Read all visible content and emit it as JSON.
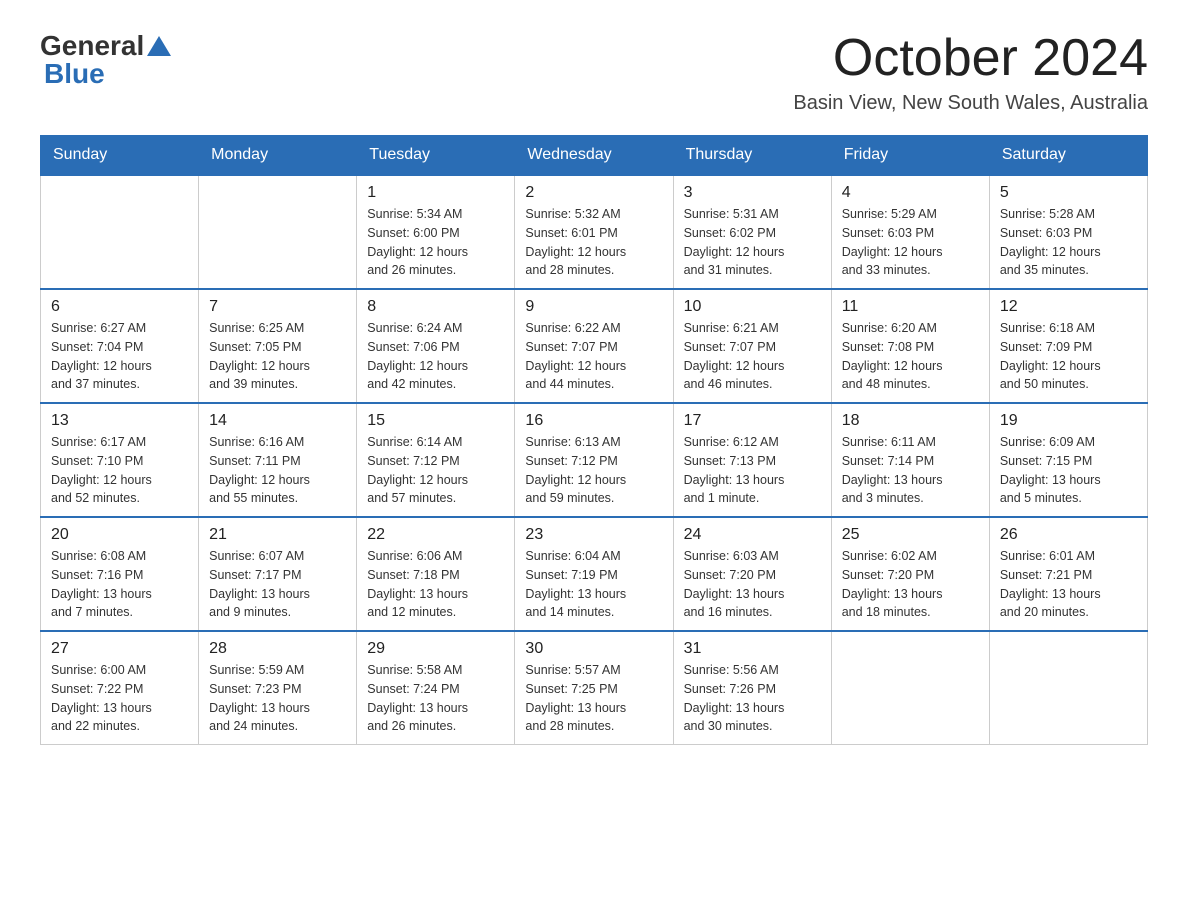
{
  "header": {
    "logo_general": "General",
    "logo_blue": "Blue",
    "month_title": "October 2024",
    "location": "Basin View, New South Wales, Australia"
  },
  "weekdays": [
    "Sunday",
    "Monday",
    "Tuesday",
    "Wednesday",
    "Thursday",
    "Friday",
    "Saturday"
  ],
  "weeks": [
    [
      {
        "day": "",
        "info": ""
      },
      {
        "day": "",
        "info": ""
      },
      {
        "day": "1",
        "info": "Sunrise: 5:34 AM\nSunset: 6:00 PM\nDaylight: 12 hours\nand 26 minutes."
      },
      {
        "day": "2",
        "info": "Sunrise: 5:32 AM\nSunset: 6:01 PM\nDaylight: 12 hours\nand 28 minutes."
      },
      {
        "day": "3",
        "info": "Sunrise: 5:31 AM\nSunset: 6:02 PM\nDaylight: 12 hours\nand 31 minutes."
      },
      {
        "day": "4",
        "info": "Sunrise: 5:29 AM\nSunset: 6:03 PM\nDaylight: 12 hours\nand 33 minutes."
      },
      {
        "day": "5",
        "info": "Sunrise: 5:28 AM\nSunset: 6:03 PM\nDaylight: 12 hours\nand 35 minutes."
      }
    ],
    [
      {
        "day": "6",
        "info": "Sunrise: 6:27 AM\nSunset: 7:04 PM\nDaylight: 12 hours\nand 37 minutes."
      },
      {
        "day": "7",
        "info": "Sunrise: 6:25 AM\nSunset: 7:05 PM\nDaylight: 12 hours\nand 39 minutes."
      },
      {
        "day": "8",
        "info": "Sunrise: 6:24 AM\nSunset: 7:06 PM\nDaylight: 12 hours\nand 42 minutes."
      },
      {
        "day": "9",
        "info": "Sunrise: 6:22 AM\nSunset: 7:07 PM\nDaylight: 12 hours\nand 44 minutes."
      },
      {
        "day": "10",
        "info": "Sunrise: 6:21 AM\nSunset: 7:07 PM\nDaylight: 12 hours\nand 46 minutes."
      },
      {
        "day": "11",
        "info": "Sunrise: 6:20 AM\nSunset: 7:08 PM\nDaylight: 12 hours\nand 48 minutes."
      },
      {
        "day": "12",
        "info": "Sunrise: 6:18 AM\nSunset: 7:09 PM\nDaylight: 12 hours\nand 50 minutes."
      }
    ],
    [
      {
        "day": "13",
        "info": "Sunrise: 6:17 AM\nSunset: 7:10 PM\nDaylight: 12 hours\nand 52 minutes."
      },
      {
        "day": "14",
        "info": "Sunrise: 6:16 AM\nSunset: 7:11 PM\nDaylight: 12 hours\nand 55 minutes."
      },
      {
        "day": "15",
        "info": "Sunrise: 6:14 AM\nSunset: 7:12 PM\nDaylight: 12 hours\nand 57 minutes."
      },
      {
        "day": "16",
        "info": "Sunrise: 6:13 AM\nSunset: 7:12 PM\nDaylight: 12 hours\nand 59 minutes."
      },
      {
        "day": "17",
        "info": "Sunrise: 6:12 AM\nSunset: 7:13 PM\nDaylight: 13 hours\nand 1 minute."
      },
      {
        "day": "18",
        "info": "Sunrise: 6:11 AM\nSunset: 7:14 PM\nDaylight: 13 hours\nand 3 minutes."
      },
      {
        "day": "19",
        "info": "Sunrise: 6:09 AM\nSunset: 7:15 PM\nDaylight: 13 hours\nand 5 minutes."
      }
    ],
    [
      {
        "day": "20",
        "info": "Sunrise: 6:08 AM\nSunset: 7:16 PM\nDaylight: 13 hours\nand 7 minutes."
      },
      {
        "day": "21",
        "info": "Sunrise: 6:07 AM\nSunset: 7:17 PM\nDaylight: 13 hours\nand 9 minutes."
      },
      {
        "day": "22",
        "info": "Sunrise: 6:06 AM\nSunset: 7:18 PM\nDaylight: 13 hours\nand 12 minutes."
      },
      {
        "day": "23",
        "info": "Sunrise: 6:04 AM\nSunset: 7:19 PM\nDaylight: 13 hours\nand 14 minutes."
      },
      {
        "day": "24",
        "info": "Sunrise: 6:03 AM\nSunset: 7:20 PM\nDaylight: 13 hours\nand 16 minutes."
      },
      {
        "day": "25",
        "info": "Sunrise: 6:02 AM\nSunset: 7:20 PM\nDaylight: 13 hours\nand 18 minutes."
      },
      {
        "day": "26",
        "info": "Sunrise: 6:01 AM\nSunset: 7:21 PM\nDaylight: 13 hours\nand 20 minutes."
      }
    ],
    [
      {
        "day": "27",
        "info": "Sunrise: 6:00 AM\nSunset: 7:22 PM\nDaylight: 13 hours\nand 22 minutes."
      },
      {
        "day": "28",
        "info": "Sunrise: 5:59 AM\nSunset: 7:23 PM\nDaylight: 13 hours\nand 24 minutes."
      },
      {
        "day": "29",
        "info": "Sunrise: 5:58 AM\nSunset: 7:24 PM\nDaylight: 13 hours\nand 26 minutes."
      },
      {
        "day": "30",
        "info": "Sunrise: 5:57 AM\nSunset: 7:25 PM\nDaylight: 13 hours\nand 28 minutes."
      },
      {
        "day": "31",
        "info": "Sunrise: 5:56 AM\nSunset: 7:26 PM\nDaylight: 13 hours\nand 30 minutes."
      },
      {
        "day": "",
        "info": ""
      },
      {
        "day": "",
        "info": ""
      }
    ]
  ]
}
